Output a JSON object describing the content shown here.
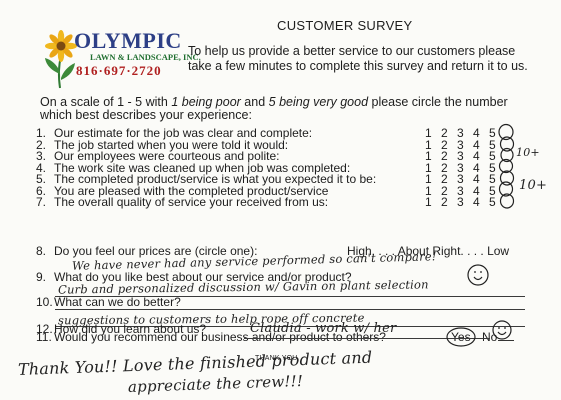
{
  "header": {
    "title": "CUSTOMER SURVEY",
    "logo_name": "OLYMPIC",
    "logo_sub": "LAWN & LANDSCAPE, INC.",
    "logo_phone": "816·697·2720",
    "intro": "To help us provide a better service to our customers please take a few minutes to complete this survey and return it to us."
  },
  "instructions": {
    "part1": "On a scale of 1 - 5 with ",
    "poor": "1 being poor",
    "part2": " and ",
    "good": "5 being very good",
    "part3": " please circle the number which best describes your experience:"
  },
  "rating_scale": [
    "1",
    "2",
    "3",
    "4",
    "5"
  ],
  "questions": [
    {
      "num": "1.",
      "text": "Our estimate for the job was clear and complete:"
    },
    {
      "num": "2.",
      "text": "The job started when you were told it would:"
    },
    {
      "num": "3.",
      "text": "Our  employees were courteous and polite:"
    },
    {
      "num": "4.",
      "text": "The work site was cleaned up when job was completed:"
    },
    {
      "num": "5.",
      "text": "The completed product/service is what you expected it to be:"
    },
    {
      "num": "6.",
      "text": "You are pleased with the completed product/service"
    },
    {
      "num": "7.",
      "text": "The overall quality of service your received from us:"
    }
  ],
  "q8": {
    "num": "8.",
    "text": "Do you feel our prices are (circle one):",
    "options": "High. . . . About Right. . . . Low",
    "answer": "We have never had any service performed so can't compare!"
  },
  "q9": {
    "num": "9.",
    "text": "What do you like best about our service and/or product?",
    "answer": "Curb and personalized discussion w/ Gavin on plant selection"
  },
  "q10": {
    "num": "10.",
    "text": "What can we do better?",
    "answer": "suggestions to customers to help rope off concrete"
  },
  "q11": {
    "num": "11.",
    "text": "Would you recommend our business and/or product to others?",
    "yes": "Yes",
    "no": "No"
  },
  "q12": {
    "num": "12.",
    "text": "How did you learn about us?",
    "answer": "Claudia - work w/ her"
  },
  "handwritten": {
    "marks_10": "10+",
    "smiley": ":)",
    "closing_line1": "Thank You!! Love the finished product and",
    "closing_line2": "appreciate the crew!!!",
    "thank_you_stamp": "THANK YOU"
  },
  "colors": {
    "logo_blue": "#2d3f86",
    "logo_green": "#1f6e2f",
    "logo_red": "#b02020",
    "ink": "#222222"
  }
}
